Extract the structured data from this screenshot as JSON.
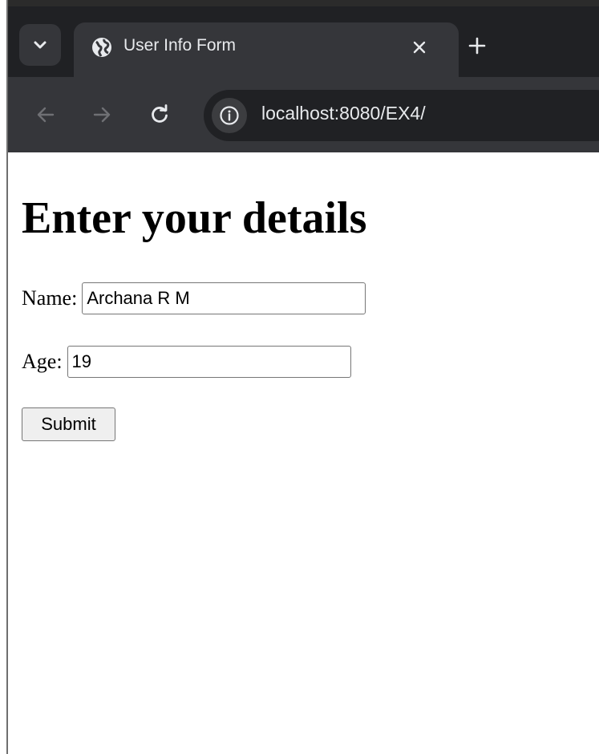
{
  "browser": {
    "tab_title": "User Info Form",
    "url_host": "localhost",
    "url_path": ":8080/EX4/",
    "icons": {
      "tab_search": "chevron-down-icon",
      "favicon": "globe-icon",
      "close": "close-icon",
      "new_tab": "plus-icon",
      "back": "arrow-left-icon",
      "forward": "arrow-right-icon",
      "reload": "reload-icon",
      "site_info": "info-icon"
    },
    "colors": {
      "tabstrip_bg": "#202124",
      "toolbar_bg": "#35363a",
      "text": "#e8eaed",
      "disabled_icon": "#6f7074"
    }
  },
  "page": {
    "heading": "Enter your details",
    "form": {
      "name_label": "Name:",
      "name_value": "Archana R M",
      "age_label": "Age:",
      "age_value": "19",
      "submit_label": "Submit"
    }
  }
}
